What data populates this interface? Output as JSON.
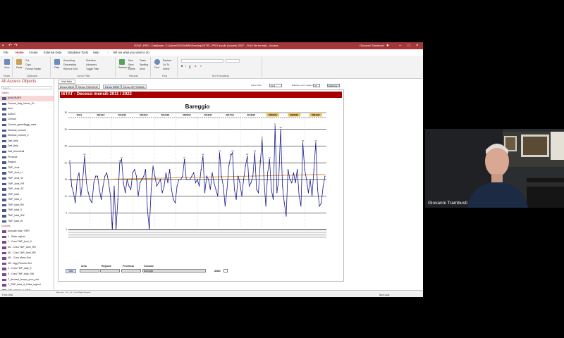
{
  "window": {
    "title": "ISTAT_PRO : Database- C:\\Users\\GIOVANNI\\Desktop\\ISTAT_PRO.accdb (Access 2007 - 2016 file format) - Access",
    "user": "Giovanni Trambusti"
  },
  "menu": {
    "items": [
      "File",
      "Home",
      "Create",
      "External Data",
      "Database Tools",
      "Help"
    ],
    "tell_me": "Tell me what you want to do",
    "active": "Home"
  },
  "ribbon": {
    "groups": [
      "Views",
      "Clipboard",
      "Sort & Filter",
      "Records",
      "Find",
      "Text Formatting"
    ],
    "buttons": {
      "view": "View",
      "paste": "Paste",
      "cut": "Cut",
      "copy": "Copy",
      "format_painter": "Format Painter",
      "ascending": "Ascending",
      "descending": "Descending",
      "remove_sort": "Remove Sort",
      "filter": "Filter",
      "selection": "Selection",
      "advanced": "Advanced",
      "toggle_filter": "Toggle Filter",
      "refresh": "Refresh All",
      "new": "New",
      "save": "Save",
      "delete": "Delete",
      "totals": "Totals",
      "spelling": "Spelling",
      "more": "More",
      "find": "Find",
      "replace": "Replace",
      "goto": "Go To",
      "select": "Select"
    }
  },
  "nav": {
    "title": "All Access Objects",
    "search_placeholder": "Search...",
    "tables_header": "Tables",
    "queries_header": "Queries",
    "tables": [
      "ANAGRAFE",
      "Comuni_Italy_Istmm_Pr...",
      "Anni",
      "AAA01",
      "Comuni",
      "Comuni_gemellaggi_mesi",
      "Decessi_comuni",
      "Decessi_comuni_2",
      "Dati_Italy",
      "Dati_Italy",
      "Dati_trimestrali",
      "Province",
      "Regioni",
      "TMP_Anni",
      "TMP_Anni_U",
      "TMP_Anni_W",
      "TMP_Anni_RR",
      "TMP_Anni_ZZ",
      "TMP_Istat",
      "TMP_Istat_2",
      "TMP_Istat_RR",
      "TMP_Istat_3",
      "TMP_Istat_SW",
      "TMP_Istat_W"
    ],
    "queries": [
      "Annuale Max / RRR",
      "1 - Stato regioni",
      "1 - Crea TMP_Anni_X",
      "M1 - Crea TMP_Anni_RR",
      "M1 - Crea TMP_Anni_RR",
      "M2 - Cons Mese Smi",
      "M3 - Agg Periodo Smi",
      "4 - Crea TMP_Istat_X",
      "5 - Crea TMP_Istat_SW",
      "T_decessi_tempo_prov_piot",
      "T_TMP_Istat_A_Dista_regioni",
      "Dati_regioni_X_Mesi",
      "Diet_frate_Istat_Mesi_4",
      "Queries"
    ]
  },
  "doc": {
    "tab": "Istat Italia",
    "form_tabs": [
      "Elenco ANNO",
      "Elenco STAGIONE",
      "Elenco MESE",
      "Elenco SETTIMANA"
    ],
    "active_form_tab": "Elenco MESE",
    "anno_label": "Anno inizio",
    "anno_value": "2011",
    "mese_label": "Rilevam. per 3 mese in",
    "mese_value": "28",
    "refresh_button": "Aggiorna",
    "banner": "ISTAT - Decessi mensili 2011 / 2022"
  },
  "filters": {
    "area_label": "Area",
    "regione_label": "Regione",
    "provincia_label": "Provincia",
    "comune_label": "Comune",
    "comune_value": "Bareggio",
    "anni_label": "ANNI",
    "italia_button": "Italia"
  },
  "recordnav": {
    "text": "Record: 14  1 of 1  No Filter  Search"
  },
  "status": {
    "left": "Form View",
    "right": "Num Lock"
  },
  "chart_data": {
    "type": "line",
    "title": "Bareggio",
    "season_labels": [
      "10/11",
      "2011/12",
      "2012/13",
      "2013/14",
      "2014/15",
      "2015/16",
      "2016/17",
      "2017/18",
      "2018/19",
      "2019/20",
      "2020/21",
      "2021/22"
    ],
    "highlighted_seasons": [
      "2019/20",
      "2020/21",
      "2021/22"
    ],
    "ylim": [
      0,
      35
    ],
    "yticks": [
      0,
      5,
      10,
      15,
      20,
      25,
      30,
      35
    ],
    "series": [
      {
        "color": "#1a1a8c",
        "values": [
          20,
          13,
          11,
          8,
          15,
          17,
          10,
          15,
          22,
          14,
          11,
          9,
          8,
          14,
          16,
          16,
          12,
          9,
          13,
          16,
          17,
          14,
          10,
          0,
          13,
          0,
          9,
          20,
          21,
          14,
          11,
          15,
          13,
          12,
          17,
          18,
          16,
          10,
          14,
          15,
          16,
          18,
          6,
          0,
          12,
          19,
          16,
          13,
          14,
          15,
          11,
          13,
          17,
          14,
          18,
          12,
          9,
          8,
          13,
          15,
          15,
          16,
          21,
          15,
          15,
          15,
          16,
          17,
          14,
          15,
          13,
          18,
          22,
          11,
          16,
          15,
          12,
          17,
          14,
          12,
          10,
          23,
          16,
          13,
          7,
          12,
          19,
          22,
          23,
          12,
          9,
          16,
          14,
          10,
          15,
          19,
          22,
          13,
          14,
          16,
          23,
          12,
          11,
          20,
          27,
          15,
          7,
          17,
          21,
          12,
          9,
          31,
          11,
          15,
          30,
          13,
          8,
          4,
          18,
          15,
          14,
          17,
          14,
          18,
          10,
          7,
          26,
          18,
          15,
          11,
          15,
          10,
          18,
          26,
          12,
          7,
          8,
          13,
          16
        ]
      },
      {
        "color": "#d99a3a",
        "values": [
          14.8,
          16.5
        ]
      }
    ]
  }
}
